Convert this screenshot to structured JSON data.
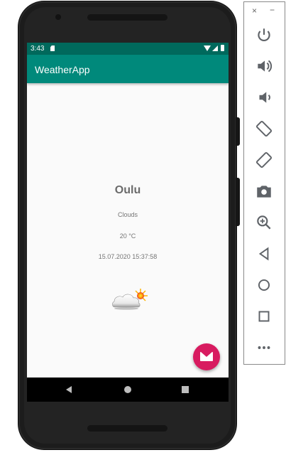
{
  "status_bar": {
    "time": "3:43"
  },
  "app_bar": {
    "title": "WeatherApp"
  },
  "weather": {
    "city": "Oulu",
    "condition": "Clouds",
    "temperature": "20 °C",
    "datetime": "15.07.2020 15:37:58",
    "icon": "cloud-sun-icon"
  },
  "fab": {
    "icon": "mail-icon",
    "color": "#d81b60"
  },
  "colors": {
    "primary": "#00897b",
    "primary_dark": "#00695c",
    "accent": "#d81b60"
  },
  "emulator_panel": {
    "window_buttons": {
      "close": "×",
      "minimize": "−"
    },
    "controls": [
      {
        "icon": "power-icon"
      },
      {
        "icon": "volume-up-icon"
      },
      {
        "icon": "volume-down-icon"
      },
      {
        "icon": "rotate-left-icon"
      },
      {
        "icon": "rotate-right-icon"
      },
      {
        "icon": "camera-icon"
      },
      {
        "icon": "zoom-icon"
      },
      {
        "icon": "back-icon"
      },
      {
        "icon": "home-icon"
      },
      {
        "icon": "overview-icon"
      },
      {
        "icon": "more-icon"
      }
    ]
  }
}
